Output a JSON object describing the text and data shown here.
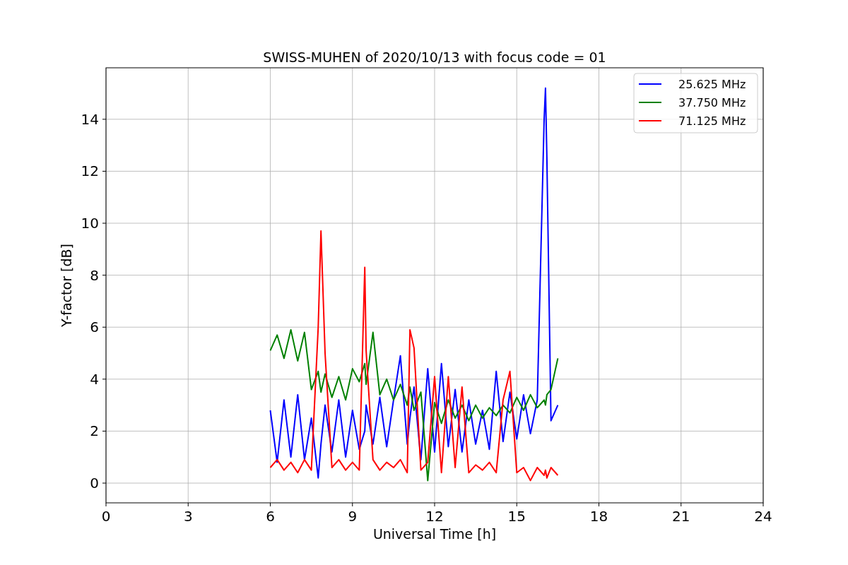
{
  "chart": {
    "chart_data": {
      "type": "line",
      "title": "SWISS-MUHEN of 2020/10/13 with focus code = 01",
      "xlabel": "Universal Time [h]",
      "ylabel": "Y-factor [dB]",
      "x": [
        6,
        6.25,
        6.5,
        6.75,
        7,
        7.25,
        7.5,
        7.75,
        7.85,
        8,
        8.25,
        8.5,
        8.75,
        9,
        9.25,
        9.45,
        9.5,
        9.75,
        10,
        10.25,
        10.5,
        10.75,
        11,
        11.1,
        11.25,
        11.5,
        11.75,
        12,
        12.25,
        12.5,
        12.75,
        13,
        13.25,
        13.5,
        13.75,
        14,
        14.25,
        14.5,
        14.75,
        15,
        15.25,
        15.5,
        15.75,
        16,
        16.05,
        16.1,
        16.25,
        16.5
      ],
      "series": [
        {
          "name": "25.625 MHz",
          "color": "#0000ff",
          "values": [
            2.8,
            0.8,
            3.2,
            1.0,
            3.4,
            0.9,
            2.5,
            0.2,
            1.5,
            3.0,
            1.2,
            3.2,
            1.0,
            2.8,
            1.3,
            2.0,
            3.0,
            1.5,
            3.3,
            1.4,
            3.2,
            4.9,
            1.5,
            2.5,
            3.7,
            0.9,
            4.4,
            1.2,
            4.6,
            1.4,
            3.6,
            1.2,
            3.2,
            1.5,
            2.8,
            1.3,
            4.3,
            1.6,
            3.5,
            1.7,
            3.4,
            1.9,
            3.2,
            14.0,
            15.2,
            12.5,
            2.4,
            3.0
          ]
        },
        {
          "name": "37.750 MHz",
          "color": "#008000",
          "values": [
            5.1,
            5.7,
            4.8,
            5.9,
            4.7,
            5.8,
            3.6,
            4.3,
            3.5,
            4.2,
            3.3,
            4.1,
            3.2,
            4.4,
            3.9,
            4.6,
            3.8,
            5.8,
            3.4,
            4.0,
            3.2,
            3.8,
            3.0,
            3.7,
            2.8,
            3.5,
            0.1,
            3.1,
            2.3,
            3.2,
            2.5,
            3.0,
            2.4,
            3.0,
            2.5,
            2.9,
            2.6,
            3.0,
            2.7,
            3.3,
            2.8,
            3.4,
            2.9,
            3.2,
            3.0,
            3.4,
            3.6,
            4.8
          ]
        },
        {
          "name": "71.125 MHz",
          "color": "#ff0000",
          "values": [
            0.6,
            0.9,
            0.5,
            0.8,
            0.4,
            0.9,
            0.5,
            6.0,
            9.7,
            5.0,
            0.6,
            0.9,
            0.5,
            0.8,
            0.5,
            8.3,
            5.1,
            0.9,
            0.5,
            0.8,
            0.6,
            0.9,
            0.4,
            5.9,
            5.2,
            0.5,
            0.8,
            4.1,
            0.4,
            4.1,
            0.6,
            3.7,
            0.4,
            0.7,
            0.5,
            0.8,
            0.4,
            3.2,
            4.3,
            0.4,
            0.6,
            0.1,
            0.6,
            0.3,
            0.5,
            0.2,
            0.6,
            0.3
          ]
        }
      ],
      "grid": true,
      "legend": true,
      "xlim": [
        0,
        24
      ],
      "ylim": [
        -0.76,
        15.98
      ],
      "xticks": [
        0,
        3,
        6,
        9,
        12,
        15,
        18,
        21,
        24
      ],
      "yticks": [
        0,
        2,
        4,
        6,
        8,
        10,
        12,
        14
      ]
    }
  }
}
